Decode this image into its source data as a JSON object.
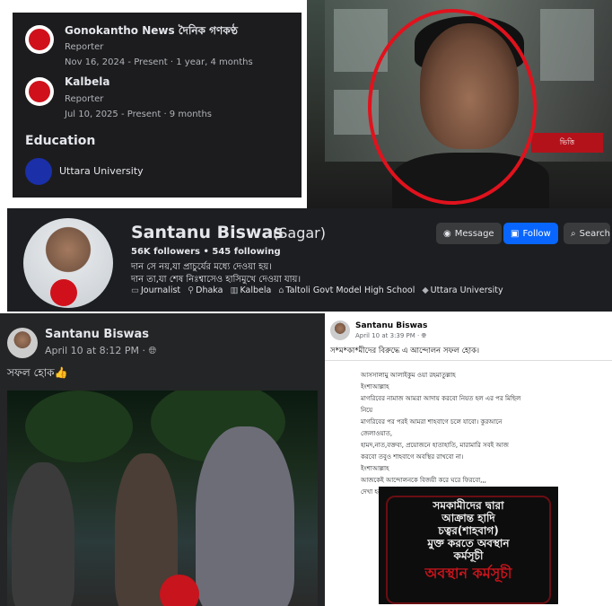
{
  "experience": {
    "jobs": [
      {
        "org": "Gonokantho News দৈনিক গণকণ্ঠ",
        "role": "Reporter",
        "dates": "Nov 16, 2024 - Present · 1 year, 4 months"
      },
      {
        "org": "Kalbela",
        "role": "Reporter",
        "dates": "Jul 10, 2025 - Present · 9 months"
      }
    ],
    "education_heading": "Education",
    "school": "Uttara University"
  },
  "photo_top": {
    "sign_text": "ভিত্তি"
  },
  "profile": {
    "name": "Santanu Biswas",
    "alt_name": "(Sagar)",
    "followers": "56K followers",
    "following": "545 following",
    "bio_line1": "দান সে নয়,যা প্রাচুর্যের মধ্যে দেওয়া হয়।",
    "bio_line2": "দান তা,যা শেষ নিঃশ্বাসেও হাসিমুখে দেওয়া যায়।",
    "tags": [
      {
        "icon": "▭",
        "label": "Journalist"
      },
      {
        "icon": "⚲",
        "label": "Dhaka"
      },
      {
        "icon": "▥",
        "label": "Kalbela"
      },
      {
        "icon": "⌂",
        "label": "Taltoli Govt Model High School"
      },
      {
        "icon": "◆",
        "label": "Uttara University"
      }
    ],
    "buttons": {
      "message": "Message",
      "follow": "Follow",
      "search": "Search"
    }
  },
  "post1": {
    "author": "Santanu Biswas",
    "time": "April 10 at 8:12 PM · ",
    "text": "সফল হোক👍"
  },
  "post2": {
    "author": "Santanu Biswas",
    "time": "April 10 at 3:39 PM · ",
    "caption": "স*ম*কা*মীদের বিরুদ্ধে এ আন্দোলন সফল হোক।",
    "message_lines": [
      "আসসালামু আলাইকুম ওয়া রহমাতুল্লাহ",
      "ইংশাআল্লাহ",
      "মাগরিবের নামাজ আমরা আদায় করবো নিয়ত হল এর পর মিছিল",
      "নিয়ে",
      "মাগরিবের পর পরই আমরা শাহবাগে চলে যাবো। কুরআনে",
      "জেলাওয়াত,",
      "হামদ,নাত,বক্তব্য, প্রয়োজনে হাতাহাতি, মারামারি সবই আজ",
      "করবো তবুও শাহবাগে অবস্থির রাখবো না।",
      "ইংশাআল্লাহ",
      "আজকেই আন্দোলনকে বিজয়ী করে ঘরে ফিরবো,,,",
      "দেখা হবে রাজপথে,,,"
    ],
    "poster_lines": [
      "সমকামীদের দ্বারা",
      "আক্রান্ত হাদি",
      "চত্বর(শাহবাগ)",
      "মুক্ত করতে অবস্থান",
      "কর্মসূচী"
    ],
    "poster_footer": "অবস্থান কর্মসূচী"
  },
  "colors": {
    "facebook_blue": "#0866ff",
    "dark_bg": "#1c1e21",
    "highlight_red": "#e0121d"
  }
}
